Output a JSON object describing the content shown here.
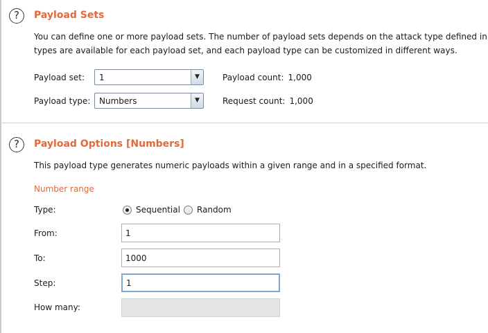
{
  "payload_sets": {
    "title": "Payload Sets",
    "help_glyph": "?",
    "desc_line1": "You can define one or more payload sets. The number of payload sets depends on the attack type defined in the P",
    "desc_line2": "types are available for each payload set, and each payload type can be customized in different ways.",
    "set_label": "Payload set:",
    "set_value": "1",
    "type_label": "Payload type:",
    "type_value": "Numbers",
    "payload_count_label": "Payload count:",
    "payload_count_value": "1,000",
    "request_count_label": "Request count:",
    "request_count_value": "1,000",
    "dropdown_glyph": "▼"
  },
  "payload_options": {
    "title": "Payload Options [Numbers]",
    "help_glyph": "?",
    "desc": "This payload type generates numeric payloads within a given range and in a specified format.",
    "section_label": "Number range",
    "type_label": "Type:",
    "type_options": [
      "Sequential",
      "Random"
    ],
    "type_selected": "Sequential",
    "from_label": "From:",
    "from_value": "1",
    "to_label": "To:",
    "to_value": "1000",
    "step_label": "Step:",
    "step_value": "1",
    "how_many_label": "How many:",
    "how_many_value": ""
  },
  "colors": {
    "accent": "#e4693a",
    "text": "#1a1a1a",
    "disabled_field": "#e3e4e6",
    "focus_border": "#7fa6d0"
  }
}
